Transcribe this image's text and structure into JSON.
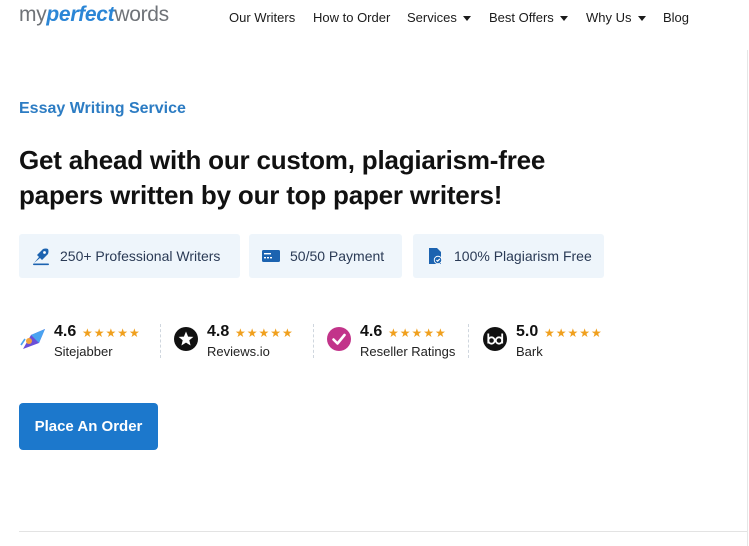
{
  "logo": {
    "part1": "my",
    "part2": "perfect",
    "part3": "words"
  },
  "nav": [
    {
      "label": "Our Writers",
      "dropdown": false
    },
    {
      "label": "How to Order",
      "dropdown": false
    },
    {
      "label": "Services",
      "dropdown": true
    },
    {
      "label": "Best Offers",
      "dropdown": true
    },
    {
      "label": "Why Us",
      "dropdown": true
    },
    {
      "label": "Blog",
      "dropdown": false
    }
  ],
  "hero": {
    "eyebrow": "Essay Writing Service",
    "headline_line1": "Get ahead with our custom, plagiarism-free",
    "headline_line2": "papers written by our top paper writers!"
  },
  "features": [
    {
      "icon": "writer-icon",
      "label": "250+ Professional Writers"
    },
    {
      "icon": "card-icon",
      "label": "50/50 Payment"
    },
    {
      "icon": "document-check-icon",
      "label": "100% Plagiarism Free"
    }
  ],
  "ratings": [
    {
      "score": "4.6",
      "stars_value": 4.6,
      "site": "Sitejabber",
      "icon": "sitejabber-icon"
    },
    {
      "score": "4.8",
      "stars_value": 4.8,
      "site": "Reviews.io",
      "icon": "reviews-io-icon"
    },
    {
      "score": "4.6",
      "stars_value": 4.6,
      "site": "Reseller Ratings",
      "icon": "reseller-ratings-icon"
    },
    {
      "score": "5.0",
      "stars_value": 5.0,
      "site": "Bark",
      "icon": "bark-icon"
    }
  ],
  "cta": {
    "label": "Place An Order"
  },
  "colors": {
    "accent": "#1c78cc",
    "eyebrow": "#2c7cc3",
    "star": "#f0a01e",
    "feature_bg": "#eef5fb"
  }
}
